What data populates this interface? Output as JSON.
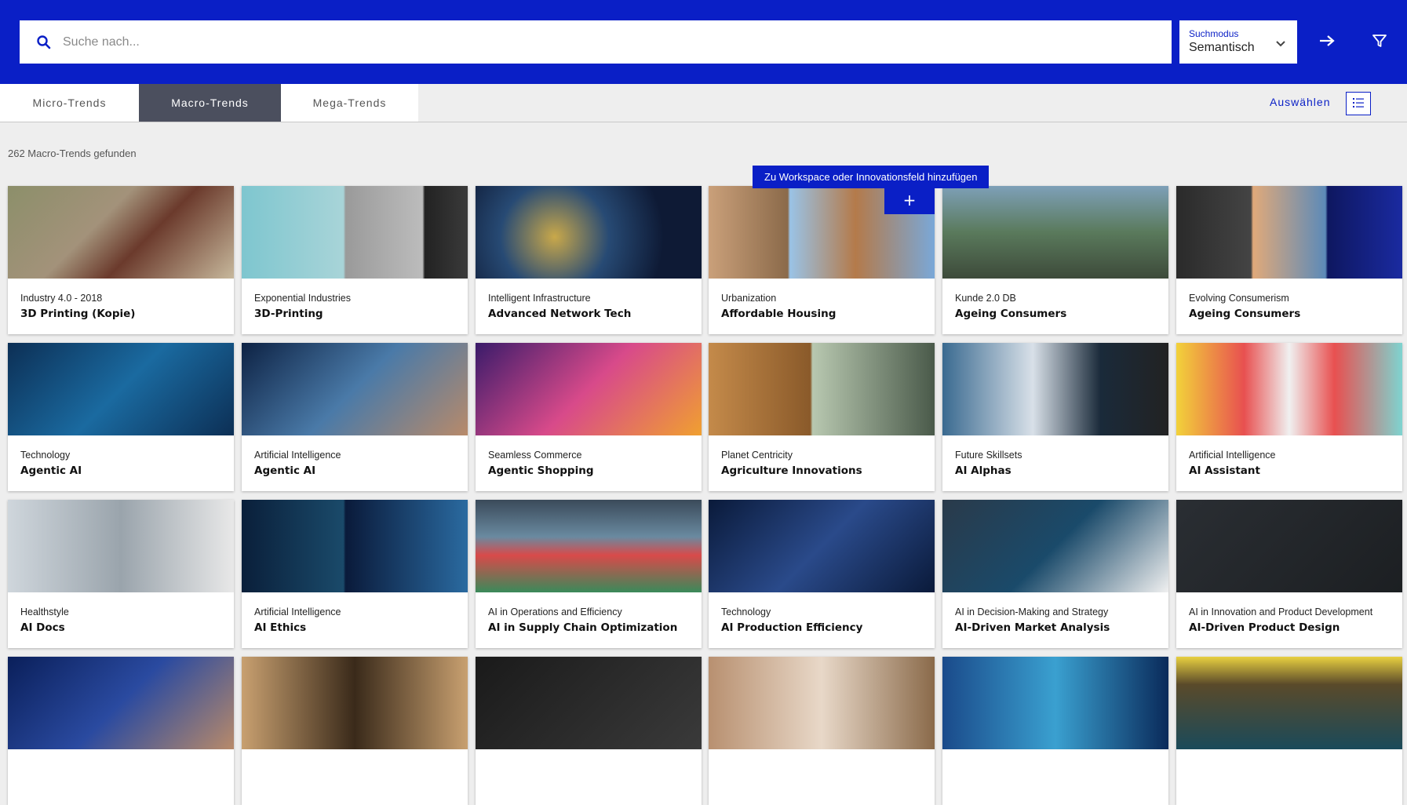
{
  "search": {
    "placeholder": "Suche nach...",
    "mode_label": "Suchmodus",
    "mode_value": "Semantisch"
  },
  "icons": {
    "search": "search-icon",
    "chevron": "chevron-down-icon",
    "go": "arrow-right-icon",
    "filter": "filter-icon",
    "list_view": "list-view-icon",
    "grid_view": "grid-view-icon",
    "add": "plus-icon"
  },
  "tabs": [
    {
      "label": "Micro-Trends"
    },
    {
      "label": "Macro-Trends"
    },
    {
      "label": "Mega-Trends"
    }
  ],
  "toolbar": {
    "select_label": "Auswählen"
  },
  "results": {
    "count_text": "262 Macro-Trends gefunden"
  },
  "tooltip": {
    "text": "Zu Workspace oder Innovationsfeld hinzufügen"
  },
  "colors": {
    "accent": "#0a1fc6",
    "active_tab": "#4b4f5e"
  },
  "cards": [
    {
      "category": "Industry 4.0 - 2018",
      "title": "3D Printing (Kopie)"
    },
    {
      "category": "Exponential Industries",
      "title": "3D-Printing"
    },
    {
      "category": "Intelligent Infrastructure",
      "title": "Advanced Network Tech"
    },
    {
      "category": "Urbanization",
      "title": "Affordable Housing",
      "add_label": "+"
    },
    {
      "category": "Kunde 2.0 DB",
      "title": "Ageing Consumers"
    },
    {
      "category": "Evolving Consumerism",
      "title": "Ageing Consumers"
    },
    {
      "category": "Technology",
      "title": "Agentic AI"
    },
    {
      "category": "Artificial Intelligence",
      "title": "Agentic AI"
    },
    {
      "category": "Seamless Commerce",
      "title": "Agentic Shopping"
    },
    {
      "category": "Planet Centricity",
      "title": "Agriculture Innovations"
    },
    {
      "category": "Future Skillsets",
      "title": "AI Alphas"
    },
    {
      "category": "Artificial Intelligence",
      "title": "AI Assistant"
    },
    {
      "category": "Healthstyle",
      "title": "AI Docs"
    },
    {
      "category": "Artificial Intelligence",
      "title": "AI Ethics"
    },
    {
      "category": "AI in Operations and Efficiency",
      "title": "AI in Supply Chain Optimization"
    },
    {
      "category": "Technology",
      "title": "AI Production Efficiency"
    },
    {
      "category": "AI in Decision-Making and Strategy",
      "title": "AI-Driven Market Analysis"
    },
    {
      "category": "AI in Innovation and Product Development",
      "title": "AI-Driven Product Design"
    },
    {
      "category": "",
      "title": ""
    },
    {
      "category": "",
      "title": ""
    },
    {
      "category": "",
      "title": ""
    },
    {
      "category": "",
      "title": ""
    },
    {
      "category": "",
      "title": ""
    },
    {
      "category": "",
      "title": ""
    }
  ]
}
